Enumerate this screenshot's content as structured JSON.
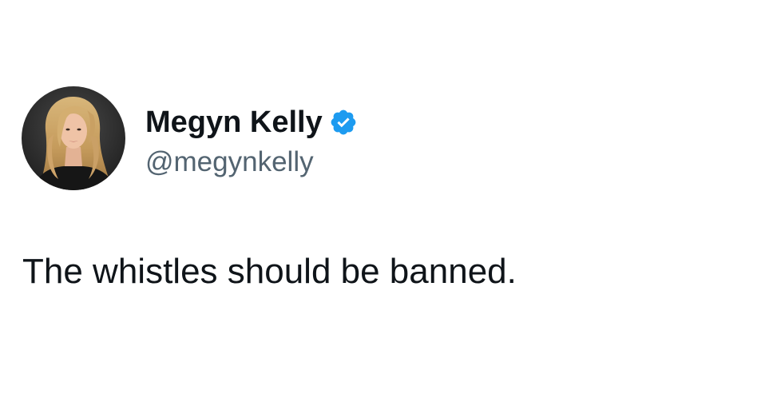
{
  "tweet": {
    "author": {
      "display_name": "Megyn Kelly",
      "handle": "@megynkelly",
      "verified": true,
      "avatar_icon": "profile-photo"
    },
    "text": "The whistles should be banned."
  },
  "colors": {
    "text_primary": "#0f1419",
    "text_secondary": "#536471",
    "verified_badge": "#1d9bf0",
    "background": "#ffffff"
  }
}
